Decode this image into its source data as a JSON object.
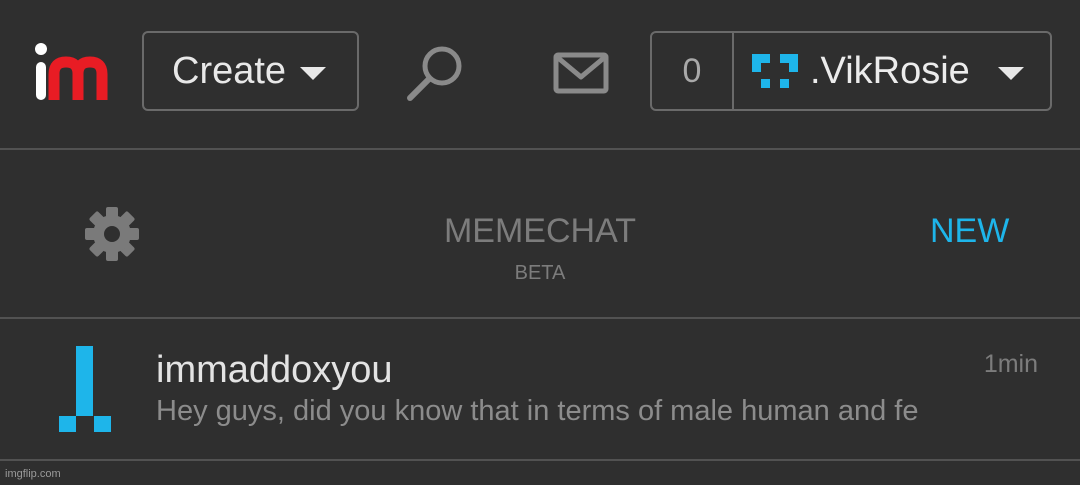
{
  "header": {
    "logo_text": "im",
    "create_label": "Create",
    "notification_count": "0",
    "username": ".VikRosie"
  },
  "memechat": {
    "title": "MEMECHAT",
    "subtitle": "BETA",
    "new_label": "NEW"
  },
  "conversations": [
    {
      "name": "immaddoxyou",
      "time": "1min",
      "preview": "Hey guys, did you know that in terms of male human and fe"
    }
  ],
  "watermark": "imgflip.com",
  "colors": {
    "background": "#2f2f2f",
    "accent": "#1eb5ea",
    "logo_red": "#e81c24",
    "border": "#6a6a6a"
  },
  "icons": [
    "search-icon",
    "mail-icon",
    "gear-icon",
    "chevron-down-icon"
  ]
}
